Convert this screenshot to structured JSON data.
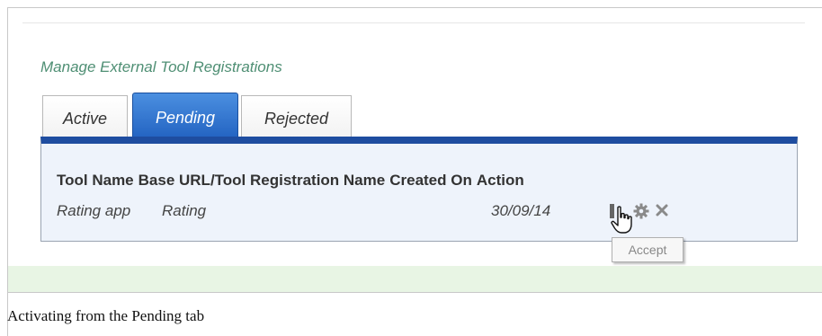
{
  "page": {
    "heading": "Manage External Tool Registrations"
  },
  "tabs": [
    {
      "label": "Active",
      "selected": false
    },
    {
      "label": "Pending",
      "selected": true
    },
    {
      "label": "Rejected",
      "selected": false
    }
  ],
  "table": {
    "columns": [
      "Tool Name",
      "Base URL/Tool Registration Name",
      "Created On",
      "Action"
    ],
    "rows": [
      {
        "tool_name": "Rating app",
        "registration_name": "Rating",
        "created_on": "30/09/14",
        "actions": [
          "accept-icon",
          "gear-icon",
          "close-icon"
        ]
      }
    ]
  },
  "tooltip": {
    "text": "Accept"
  },
  "caption": "Activating from the Pending tab",
  "colors": {
    "heading_green": "#4f8f74",
    "tab_active_blue": "#1f5fbf",
    "panel_bar": "#1e4da0"
  }
}
